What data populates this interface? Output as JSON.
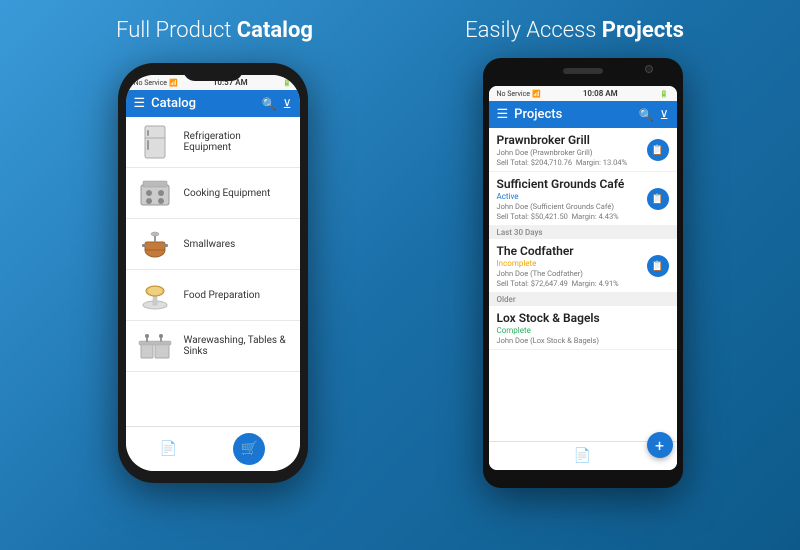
{
  "left_section": {
    "title": "Full Product ",
    "title_bold": "Catalog",
    "phone": {
      "status_bar": {
        "signal": "No Service",
        "wifi": "▾",
        "time": "10:57 AM",
        "battery": "■■■"
      },
      "app_bar": {
        "title": "Catalog",
        "menu_icon": "☰",
        "search_icon": "🔍",
        "filter_icon": "▽"
      },
      "catalog_items": [
        {
          "label": "Refrigeration Equipment",
          "icon": "fridge"
        },
        {
          "label": "Cooking Equipment",
          "icon": "stove"
        },
        {
          "label": "Smallwares",
          "icon": "pot"
        },
        {
          "label": "Food Preparation",
          "icon": "scale"
        },
        {
          "label": "Warewashing, Tables & Sinks",
          "icon": "sink"
        }
      ],
      "bottom_nav": {
        "doc_icon": "📄",
        "cart_icon": "🛒"
      }
    }
  },
  "right_section": {
    "title": "Easily Access ",
    "title_bold": "Projects",
    "phone": {
      "status_bar": {
        "signal": "No Service",
        "wifi": "▾",
        "time": "10:08 AM",
        "battery": "■■"
      },
      "app_bar": {
        "title": "Projects",
        "menu_icon": "☰",
        "search_icon": "🔍",
        "filter_icon": "▽"
      },
      "projects": [
        {
          "name": "Prawnbroker Grill",
          "status": "",
          "person": "John Doe (Prawnbroker Grill)",
          "sell_total": "Sell Total: $204,710.76",
          "margin": "Margin: 13.04%",
          "has_doc": true,
          "section": null
        },
        {
          "name": "Sufficient Grounds Café",
          "status": "Active",
          "status_type": "active",
          "person": "John Doe (Sufficient Grounds Café)",
          "sell_total": "Sell Total: $50,421.50",
          "margin": "Margin: 4.43%",
          "has_doc": true,
          "section": null
        },
        {
          "name": "The Codfather",
          "status": "Incomplete",
          "status_type": "incomplete",
          "person": "John Doe (The Codfather)",
          "sell_total": "Sell Total: $72,647.49",
          "margin": "Margin: 4.91%",
          "has_doc": true,
          "section": "Last 30 Days"
        },
        {
          "name": "Lox Stock & Bagels",
          "status": "Complete",
          "status_type": "complete",
          "person": "John Doe (Lox Stock & Bagels)",
          "sell_total": "",
          "margin": "",
          "has_doc": false,
          "section": "Older"
        }
      ],
      "bottom_nav": {
        "doc_icon": "📄",
        "add_icon": "+"
      }
    }
  }
}
